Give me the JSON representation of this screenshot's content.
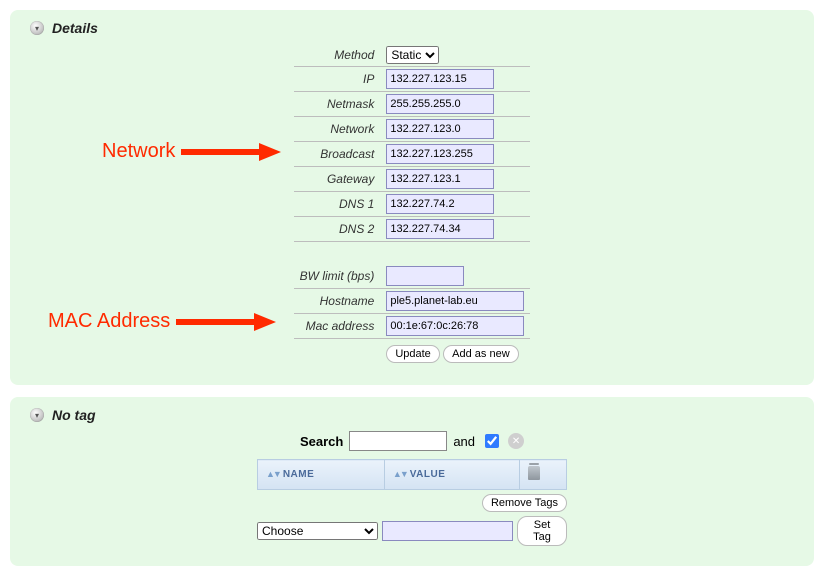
{
  "details": {
    "title": "Details",
    "labels": {
      "method": "Method",
      "ip": "IP",
      "netmask": "Netmask",
      "network": "Network",
      "broadcast": "Broadcast",
      "gateway": "Gateway",
      "dns1": "DNS 1",
      "dns2": "DNS 2",
      "bwlimit": "BW limit (bps)",
      "hostname": "Hostname",
      "mac": "Mac address"
    },
    "values": {
      "method": "Static",
      "ip": "132.227.123.15",
      "netmask": "255.255.255.0",
      "network": "132.227.123.0",
      "broadcast": "132.227.123.255",
      "gateway": "132.227.123.1",
      "dns1": "132.227.74.2",
      "dns2": "132.227.74.34",
      "bwlimit": "",
      "hostname": "ple5.planet-lab.eu",
      "mac": "00:1e:67:0c:26:78"
    },
    "buttons": {
      "update": "Update",
      "addnew": "Add as new"
    }
  },
  "annotations": {
    "network": "Network",
    "mac": "MAC Address"
  },
  "tags": {
    "title": "No tag",
    "search_label": "Search",
    "and_label": "and",
    "col_name": "NAME",
    "col_value": "VALUE",
    "remove_btn": "Remove Tags",
    "choose_option": "Choose",
    "settag_btn": "Set Tag"
  }
}
